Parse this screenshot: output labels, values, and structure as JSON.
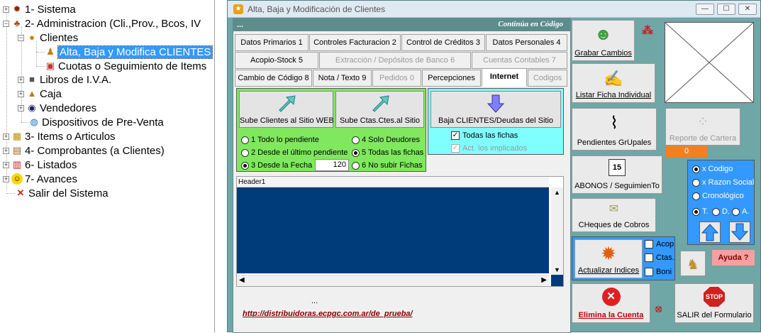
{
  "tree": {
    "items": [
      {
        "label": "1- Sistema",
        "icon": "gear-icon"
      },
      {
        "label": "2- Administracion (Cli.,Prov., Bcos, IV",
        "icon": "people-icon"
      },
      {
        "label": "Clientes",
        "icon": "clients-icon"
      },
      {
        "label": "Alta, Baja y Modifica CLIENTES",
        "icon": "person-icon"
      },
      {
        "label": "Cuotas o Seguimiento de Items",
        "icon": "document-icon"
      },
      {
        "label": "Libros de I.V.A.",
        "icon": "book-icon"
      },
      {
        "label": "Caja",
        "icon": "cash-icon"
      },
      {
        "label": "Vendedores",
        "icon": "vendor-icon"
      },
      {
        "label": "Dispositivos de Pre-Venta",
        "icon": "globe-icon"
      },
      {
        "label": "3- Items o Articulos",
        "icon": "box-icon"
      },
      {
        "label": "4- Comprobantes (a Clientes)",
        "icon": "receipt-icon"
      },
      {
        "label": "6- Listados",
        "icon": "chart-icon"
      },
      {
        "label": "7- Avances",
        "icon": "smiley-icon"
      },
      {
        "label": "Salir del Sistema",
        "icon": "exit-icon"
      }
    ]
  },
  "window": {
    "title": "Alta, Baja y Modificación de Clientes",
    "min": "—",
    "max": "☐",
    "close": "✕"
  },
  "header": {
    "left": "...",
    "right": "Continúa en Código"
  },
  "tabs": {
    "r1": [
      "Datos Primarios 1",
      "Controles Facturacion 2",
      "Control de Créditos 3",
      "Datos Personales 4"
    ],
    "r2": [
      "Acopio-Stock 5",
      "Extracción / Depósitos de Banco 6",
      "Cuentas Contables 7"
    ],
    "r3": [
      "Cambio de Código 8",
      "Nota / Texto 9",
      "Pedidos 0",
      "Percepciones",
      "Internet",
      "Codigos"
    ]
  },
  "internet": {
    "upload_web": "Sube Clientes al Sitio WEB",
    "upload_ctas": "Sube Ctas.Ctes.al Sitio",
    "download": "Baja CLIENTES/Deudas del Sitio",
    "radios": [
      "1 Todo lo pendiente",
      "2 Desde el último pendiente",
      "3 Desde la Fecha",
      "4 Solo Deudores",
      "5 Todas las fichas",
      "6 No subir Fichas"
    ],
    "days": "120",
    "chk_all": "Todas las fichas",
    "chk_act": "Act. los implicados"
  },
  "grid": {
    "header": "Header1"
  },
  "footer": {
    "dots": "...",
    "url": "http://distribuidoras.ecpgc.com.ar/de_prueba/"
  },
  "right": {
    "grabar": "Grabar Cambios",
    "listar": "Listar Ficha Individual",
    "pendientes": "Pendientes GrUpales",
    "reporte": "Reporte de Cartera",
    "reporte_val": "0",
    "abonos": "ABONOS / SeguimienTo",
    "cheques": "CHeques de Cobros",
    "actualizar": "Actualizar Indices",
    "acop": "Acop",
    "ctas": "Ctas.",
    "boni": "Boni",
    "ayuda": "Ayuda ?",
    "elimina": "Elimina la Cuenta",
    "salir": "SALIR del Formulario",
    "stop": "STOP",
    "sort": {
      "codigo": "x Codigo",
      "razon": "x Razon Social",
      "crono": "Cronológico",
      "t": "T.",
      "d": "D.",
      "a": "A."
    }
  },
  "colors": {
    "accent": "#3399ff",
    "green": "#7fe85e",
    "cyan": "#80ffff",
    "navy": "#003b7a",
    "window": "#6fa6a6"
  }
}
